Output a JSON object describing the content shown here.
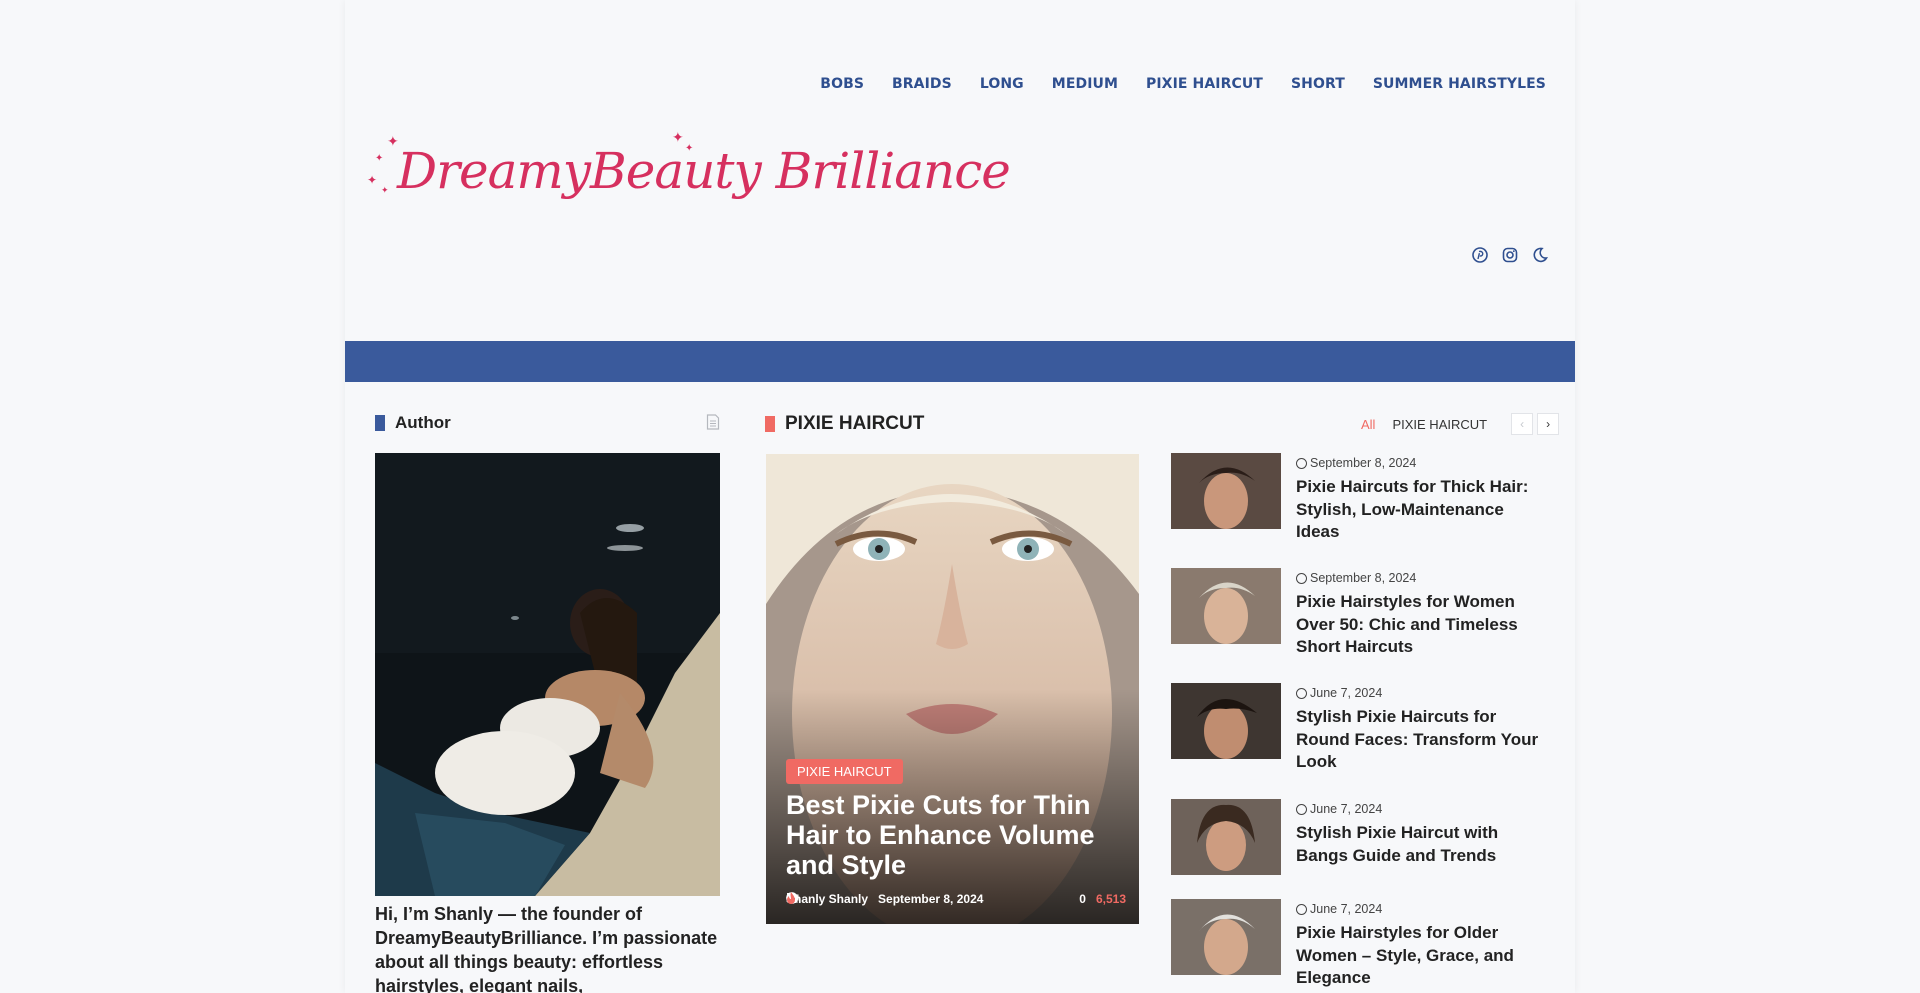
{
  "nav": [
    "BOBS",
    "BRAIDS",
    "LONG",
    "MEDIUM",
    "PIXIE HAIRCUT",
    "SHORT",
    "SUMMER HAIRSTYLES"
  ],
  "logo": {
    "text": "DreamyBeauty Brilliance"
  },
  "header_icons": [
    "pinterest-icon",
    "instagram-icon",
    "moon-icon"
  ],
  "colors": {
    "brand": "#d6305f",
    "nav": "#2f4f8f",
    "bar": "#3a5a9c",
    "accent": "#f06a63"
  },
  "author": {
    "heading": "Author",
    "bio": "Hi, I’m Shanly — the founder of DreamyBeautyBrilliance. I’m passionate about all things beauty: effortless hairstyles, elegant nails,"
  },
  "pixie": {
    "heading": "PIXIE HAIRCUT",
    "filter_all": "All",
    "filter_cat": "PIXIE HAIRCUT",
    "prev": "‹",
    "next": "›",
    "featured": {
      "category": "PIXIE HAIRCUT",
      "title": "Best Pixie Cuts for Thin Hair to Enhance Volume and Style",
      "author": "Shanly Shanly",
      "date": "September 8, 2024",
      "comments": "0",
      "views": "6,513"
    },
    "items": [
      {
        "date": "September 8, 2024",
        "title": "Pixie Haircuts for Thick Hair: Stylish, Low-Maintenance Ideas"
      },
      {
        "date": "September 8, 2024",
        "title": "Pixie Hairstyles for Women Over 50: Chic and Timeless Short Haircuts"
      },
      {
        "date": "June 7, 2024",
        "title": "Stylish Pixie Haircuts for Round Faces: Transform Your Look"
      },
      {
        "date": "June 7, 2024",
        "title": "Stylish Pixie Haircut with Bangs Guide and Trends"
      },
      {
        "date": "June 7, 2024",
        "title": "Pixie Hairstyles for Older Women – Style, Grace, and Elegance"
      }
    ]
  }
}
